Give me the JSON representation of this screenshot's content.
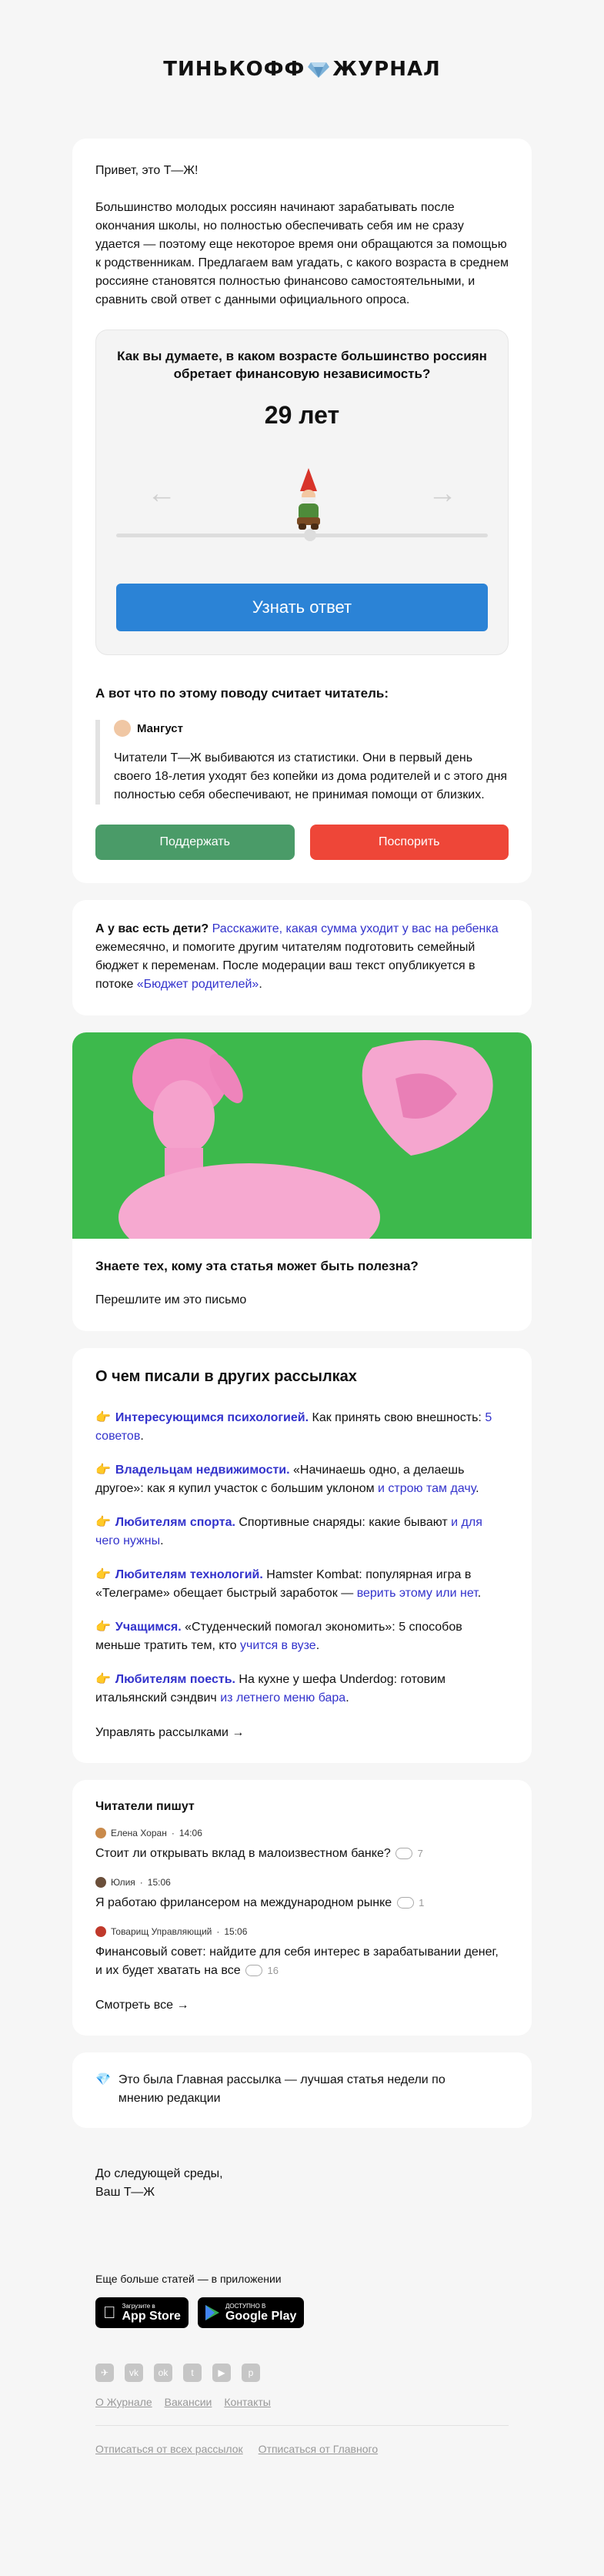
{
  "header": {
    "logo_left": "ТИНЬКОФФ",
    "logo_right": "ЖУРНАЛ"
  },
  "intro": {
    "greeting": "Привет, это Т—Ж!",
    "body": "Большинство молодых россиян начинают зарабатывать после окончания школы, но полностью обеспечивать себя им не сразу удается — поэтому еще некоторое время они обращаются за помощью к родственникам. Предлагаем вам угадать, с какого возраста в среднем россияне становятся полностью финансово самостоятельными, и сравнить свой ответ с данными официального опроса."
  },
  "quiz": {
    "question": "Как вы думаете, в каком возрасте большинство россиян обретает финансовую независимость?",
    "age": "29 лет",
    "left_arrow": "←",
    "right_arrow": "→",
    "button": "Узнать ответ",
    "slider_value": 29
  },
  "reader": {
    "heading": "А вот что по этому поводу считает читатель:",
    "author": "Мангуст",
    "text": "Читатели Т—Ж выбиваются из статистики. Они в первый день своего 18-летия уходят без копейки из дома родителей и с этого дня полностью себя обеспечивают, не принимая помощи от близких.",
    "support": "Поддержать",
    "argue": "Поспорить"
  },
  "kids": {
    "lead": "А у вас есть дети?",
    "link1": "Расскажите, какая сумма уходит у вас на ребенка",
    "mid": " ежемесячно, и помогите другим читателям подготовить семейный бюджет к переменам. После модерации ваш текст опубликуется в потоке ",
    "link2": "«Бюджет родителей»",
    "end": "."
  },
  "share": {
    "title": "Знаете тех, кому эта статья может быть полезна?",
    "text": "Перешлите им это письмо"
  },
  "other": {
    "heading": "О чем писали в других рассылках",
    "items": [
      {
        "topic": "Интересующимся психологией.",
        "text": " Как принять свою внешность: ",
        "link": "5 советов",
        "end": "."
      },
      {
        "topic": "Владельцам недвижимости.",
        "text": " «Начинаешь одно, а делаешь другое»: как я купил участок с большим уклоном ",
        "link": "и строю там дачу",
        "end": "."
      },
      {
        "topic": "Любителям спорта.",
        "text": " Спортивные снаряды: какие бывают ",
        "link": "и для чего нужны",
        "end": "."
      },
      {
        "topic": "Любителям технологий.",
        "text": " Hamster Kombat: популярная игра в «Телеграме» обещает быстрый заработок — ",
        "link": "верить этому или нет",
        "end": "."
      },
      {
        "topic": "Учащимся.",
        "text": " «Студенческий помогал экономить»: 5 способов меньше тратить тем, кто ",
        "link": "учится в вузе",
        "end": "."
      },
      {
        "topic": "Любителям поесть.",
        "text": " На кухне у шефа Underdog: готовим итальянский сэндвич ",
        "link": "из летнего меню бара",
        "end": "."
      }
    ],
    "manage": "Управлять рассылками →"
  },
  "readers_write": {
    "heading": "Читатели пишут",
    "posts": [
      {
        "author": "Елена Хоран",
        "time": "14:06",
        "question": "Стоит ли открывать вклад в малоизвестном банке?",
        "count": "7"
      },
      {
        "author": "Юлия",
        "time": "15:06",
        "question": "Я работаю фрилансером на международном рынке",
        "count": "1"
      },
      {
        "author": "Товарищ Управляющий",
        "time": "15:06",
        "question": "Финансовый совет: найдите для себя интерес в зарабатывании денег, и их будет хватать на все",
        "count": "16"
      }
    ],
    "more": "Смотреть все →"
  },
  "main_note": {
    "text": "Это была Главная рассылка — лучшая статья недели по мнению редакции"
  },
  "signoff": {
    "line1": "До следующей среды,",
    "line2": "Ваш Т—Ж"
  },
  "app": {
    "label": "Еще больше статей — в приложении",
    "appstore_small": "Загрузите в",
    "appstore_big": "App Store",
    "gplay_small": "ДОСТУПНО В",
    "gplay_big": "Google Play"
  },
  "footer": {
    "links": [
      "О Журнале",
      "Вакансии",
      "Контакты"
    ],
    "unsub_all": "Отписаться от всех рассылок",
    "unsub_main": "Отписаться от Главного"
  }
}
